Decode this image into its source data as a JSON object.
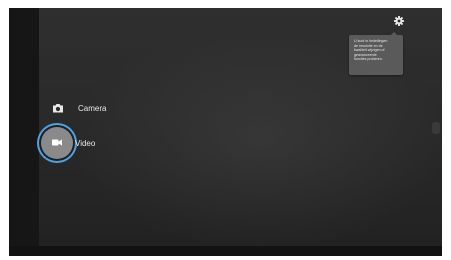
{
  "modes": {
    "camera_label": "Camera",
    "video_label": "Video",
    "selected": "Video"
  },
  "settings": {
    "icon": "gear-icon",
    "tooltip_lines": [
      "U kunt in Instellingen",
      "de resolutie en de",
      "kwaliteit wijzigen of",
      "geavanceerde",
      "functies proberen."
    ]
  },
  "colors": {
    "focus_ring": "#4aa3e6",
    "video_button": "#8a8a8a",
    "background": "#2a2a2a"
  }
}
